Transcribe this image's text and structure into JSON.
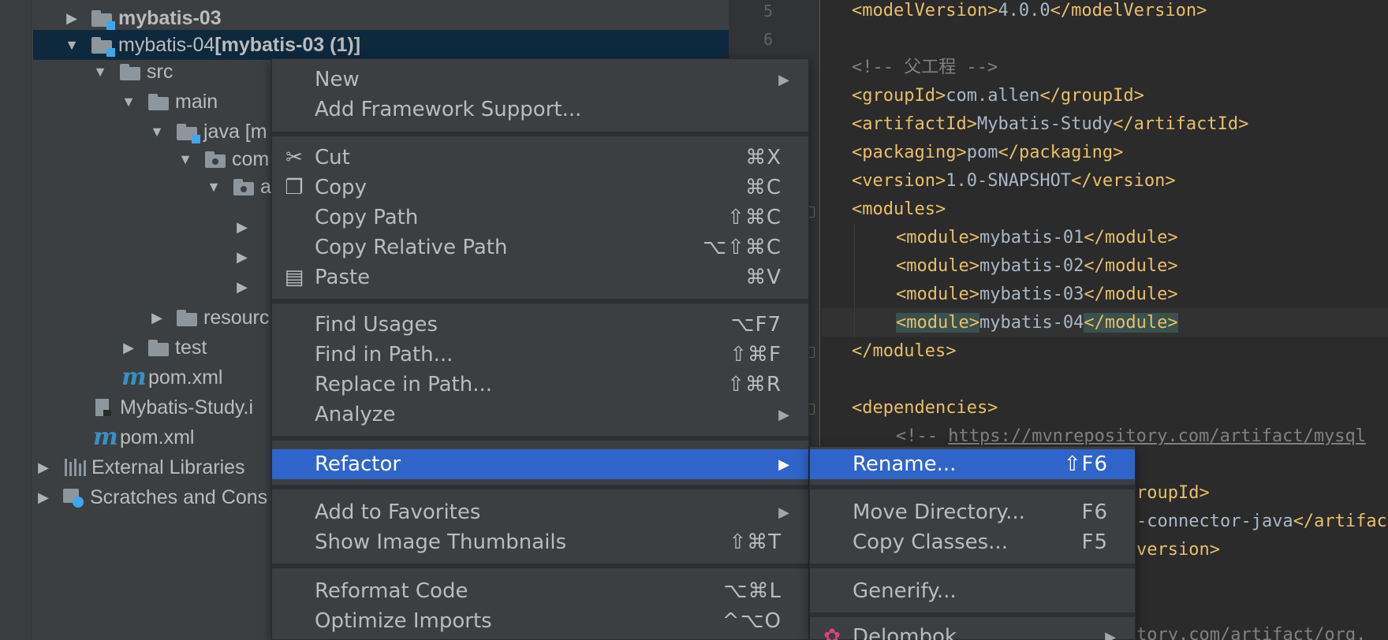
{
  "tree": {
    "items": [
      {
        "label": "mybatis-03",
        "label2": ""
      },
      {
        "label": "mybatis-04 ",
        "label2": "[mybatis-03 (1)]"
      },
      {
        "label": "src"
      },
      {
        "label": "main"
      },
      {
        "label": "java [m"
      },
      {
        "label": "com"
      },
      {
        "label": "a"
      },
      {
        "label": "resourc"
      },
      {
        "label": "test"
      },
      {
        "label": "pom.xml"
      },
      {
        "label": "Mybatis-Study.i"
      },
      {
        "label": "pom.xml"
      },
      {
        "label": "External Libraries"
      },
      {
        "label": "Scratches and Cons"
      }
    ]
  },
  "gutter": {
    "line_numbers": [
      "5",
      "6"
    ]
  },
  "editor": {
    "line_model": {
      "open": "<modelVersion>",
      "text": "4.0.0",
      "close": "</modelVersion>"
    },
    "line_comment": "<!-- 父工程 -->",
    "line_group": {
      "open": "<groupId>",
      "text": "com.allen",
      "close": "</groupId>"
    },
    "line_artifact": {
      "open": "<artifactId>",
      "text": "Mybatis-Study",
      "close": "</artifactId>"
    },
    "line_packaging": {
      "open": "<packaging>",
      "text": "pom",
      "close": "</packaging>"
    },
    "line_version": {
      "open": "<version>",
      "text": "1.0-SNAPSHOT",
      "close": "</version>"
    },
    "line_modules_open": "<modules>",
    "modules": [
      {
        "open": "<module>",
        "text": "mybatis-01",
        "close": "</module>"
      },
      {
        "open": "<module>",
        "text": "mybatis-02",
        "close": "</module>"
      },
      {
        "open": "<module>",
        "text": "mybatis-03",
        "close": "</module>"
      },
      {
        "open": "<module>",
        "text": "mybatis-04",
        "close": "</module>"
      }
    ],
    "line_modules_close": "</modules>",
    "line_deps_open": "<dependencies>",
    "line_mvn_comment_prefix": "<!-- ",
    "line_mvn_comment_url": "https://mvnrepository.com/artifact/mysql",
    "line_frag_group": "roupId>",
    "line_frag_artifact_text": "-connector-java",
    "line_frag_artifact_tag": "</artifac",
    "line_frag_version": "version>",
    "line_frag_url": "tory.com/artifact/org."
  },
  "context_menu": {
    "items": [
      {
        "label": "New",
        "shortcut": "",
        "submenu": true
      },
      {
        "label": "Add Framework Support...",
        "shortcut": ""
      },
      {
        "label": "Cut",
        "shortcut": "⌘X",
        "icon": "scissors-icon"
      },
      {
        "label": "Copy",
        "shortcut": "⌘C",
        "icon": "copy-icon"
      },
      {
        "label": "Copy Path",
        "shortcut": "⇧⌘C"
      },
      {
        "label": "Copy Relative Path",
        "shortcut": "⌥⇧⌘C"
      },
      {
        "label": "Paste",
        "shortcut": "⌘V",
        "icon": "paste-icon"
      },
      {
        "label": "Find Usages",
        "shortcut": "⌥F7"
      },
      {
        "label": "Find in Path...",
        "shortcut": "⇧⌘F"
      },
      {
        "label": "Replace in Path...",
        "shortcut": "⇧⌘R"
      },
      {
        "label": "Analyze",
        "shortcut": "",
        "submenu": true
      },
      {
        "label": "Refactor",
        "shortcut": "",
        "submenu": true,
        "selected": true
      },
      {
        "label": "Add to Favorites",
        "shortcut": "",
        "submenu": true
      },
      {
        "label": "Show Image Thumbnails",
        "shortcut": "⇧⌘T"
      },
      {
        "label": "Reformat Code",
        "shortcut": "⌥⌘L"
      },
      {
        "label": "Optimize Imports",
        "shortcut": "^⌥O"
      }
    ]
  },
  "refactor_submenu": {
    "items": [
      {
        "label": "Rename...",
        "shortcut": "⇧F6",
        "selected": true
      },
      {
        "label": "Move Directory...",
        "shortcut": "F6"
      },
      {
        "label": "Copy Classes...",
        "shortcut": "F5"
      },
      {
        "label": "Generify...",
        "shortcut": ""
      },
      {
        "label": "Delombok",
        "shortcut": "",
        "submenu": true
      }
    ]
  },
  "colors": {
    "selection": "#2f65ca",
    "tree_selected": "#0d293e",
    "xml_tag": "#e8bf6a",
    "xml_text": "#a9b7c6",
    "comment": "#808080"
  }
}
